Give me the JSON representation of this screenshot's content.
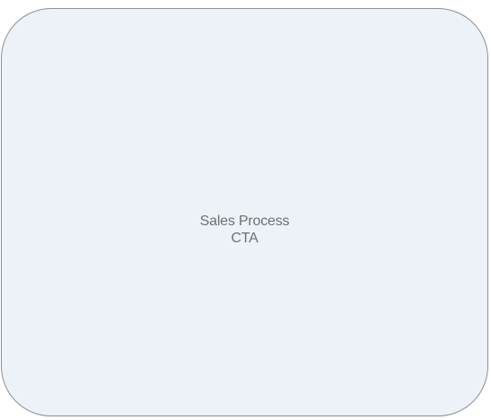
{
  "placeholder": {
    "line1": "Sales Process",
    "line2": "CTA"
  },
  "colors": {
    "box_fill": "#edf1f8",
    "box_border": "#8c8f94",
    "text": "#6f6f6f"
  }
}
